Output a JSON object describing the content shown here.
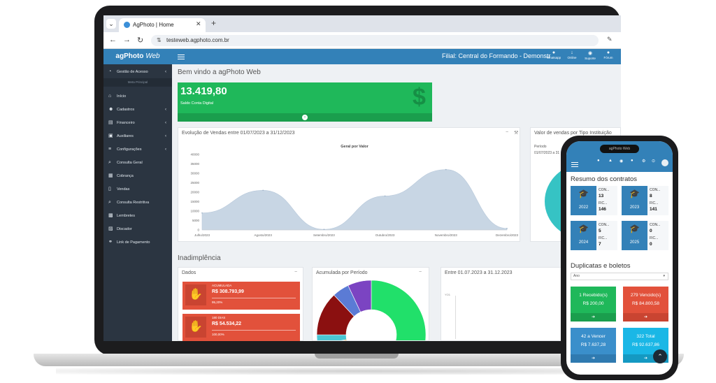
{
  "browser": {
    "tab_title": "AgPhoto | Home",
    "url": "testeweb.agphoto.com.br"
  },
  "app": {
    "brand": "agPhoto",
    "brand_suffix": "Web",
    "filial": "Filial: Central do Formando - Demonstr",
    "top_icons": [
      {
        "label": "Whatsapp",
        "icon": "whatsapp-icon"
      },
      {
        "label": "Online",
        "icon": "online-icon"
      },
      {
        "label": "Suporte",
        "icon": "support-icon"
      },
      {
        "label": "Fórum",
        "icon": "forum-icon"
      }
    ]
  },
  "sidebar": {
    "gestao": "Gestão de Acesso",
    "sub": "Meta Principal",
    "items": [
      {
        "label": "Início",
        "icon": "home-icon",
        "arrow": false
      },
      {
        "label": "Cadastros",
        "icon": "users-icon",
        "arrow": true
      },
      {
        "label": "Financeiro",
        "icon": "money-icon",
        "arrow": true
      },
      {
        "label": "Auxiliares",
        "icon": "book-icon",
        "arrow": true
      },
      {
        "label": "Configurações",
        "icon": "list-icon",
        "arrow": true
      },
      {
        "label": "Consulta Geral",
        "icon": "search-icon",
        "arrow": false
      },
      {
        "label": "Cobrança",
        "icon": "bill-icon",
        "arrow": false
      },
      {
        "label": "Vendas",
        "icon": "mobile-icon",
        "arrow": false
      },
      {
        "label": "Consulta Restritiva",
        "icon": "search-icon",
        "arrow": false
      },
      {
        "label": "Lembretes",
        "icon": "note-icon",
        "arrow": false
      },
      {
        "label": "Discador",
        "icon": "phone-icon",
        "arrow": false
      },
      {
        "label": "Link de Pagamento",
        "icon": "link-icon",
        "arrow": false
      }
    ]
  },
  "main": {
    "welcome": "Bem vindo a agPhoto Web",
    "saldo_value": "13.419,80",
    "saldo_label": "Saldo Conta Digital",
    "vendas_title": "Evolução de Vendas entre 01/07/2023 a 31/12/2023",
    "tipo_title": "Valor de vendas por Tipo Instituição",
    "tipo_periodo": "Período",
    "tipo_date": "01/07/2023 a 31",
    "inad_title": "Inadimplência",
    "dados_title": "Dados",
    "acum_title": "Acumulada por Período",
    "entre_title": "Entre 01.07.2023 a 31.12.2023",
    "entre_axis": "YO1",
    "kpis": [
      {
        "caption": "ACUMULADA",
        "value": "R$ 308.793,99",
        "pct": "95,20%"
      },
      {
        "caption": "180 DIAS",
        "value": "R$ 54.534,22",
        "pct": "100,00%"
      }
    ]
  },
  "chart_data": [
    {
      "type": "area",
      "title": "Geral por Valor",
      "categories": [
        "Julho/2023",
        "Agosto/2023",
        "Setembro/2023",
        "Outubro/2023",
        "Novembro/2023",
        "Dezembro/2023"
      ],
      "values": [
        9000,
        21000,
        300,
        18000,
        32000,
        800
      ],
      "yticks": [
        "40000",
        "35000",
        "30000",
        "25000",
        "20000",
        "15000",
        "10000",
        "5000",
        "0"
      ],
      "ylim": [
        0,
        40000
      ],
      "color": "#c8d6e4"
    },
    {
      "type": "pie",
      "title": "",
      "values": [
        64,
        4,
        4,
        3,
        13,
        5,
        7
      ],
      "colors": [
        "#21e06a",
        "#4a90c8",
        "#f5a623",
        "#4ac6d4",
        "#8b1010",
        "#5b7bd5",
        "#7b44c2"
      ]
    }
  ],
  "phone": {
    "island": "agPhoto Web",
    "resumo_title": "Resumo dos contratos",
    "cards": [
      {
        "year": "2022",
        "con": "CON...",
        "n1": "13",
        "fic": "FIC...",
        "n2": "146"
      },
      {
        "year": "2023",
        "con": "CON...",
        "n1": "8",
        "fic": "FIC...",
        "n2": "141"
      },
      {
        "year": "2024",
        "con": "CON...",
        "n1": "5",
        "fic": "FIC...",
        "n2": "7"
      },
      {
        "year": "2025",
        "con": "CON...",
        "n1": "0",
        "fic": "FIC...",
        "n2": "0"
      }
    ],
    "dup_title": "Duplicatas e boletos",
    "select_value": "Ano",
    "tiles": [
      {
        "t1": "1 Recebido(s)",
        "t2": "R$ 200,00",
        "color": "#1fb85a",
        "dark": "#1a9e4d"
      },
      {
        "t1": "279 Vencido(s)",
        "t2": "R$ 84.800,58",
        "color": "#e2513b",
        "dark": "#c94431"
      },
      {
        "t1": "42 a Vencer",
        "t2": "R$ 7.637,28",
        "color": "#3a8fcb",
        "dark": "#2f7ab0"
      },
      {
        "t1": "322 Total",
        "t2": "R$ 92.637,86",
        "color": "#1ab7e6",
        "dark": "#1499c2"
      }
    ]
  }
}
